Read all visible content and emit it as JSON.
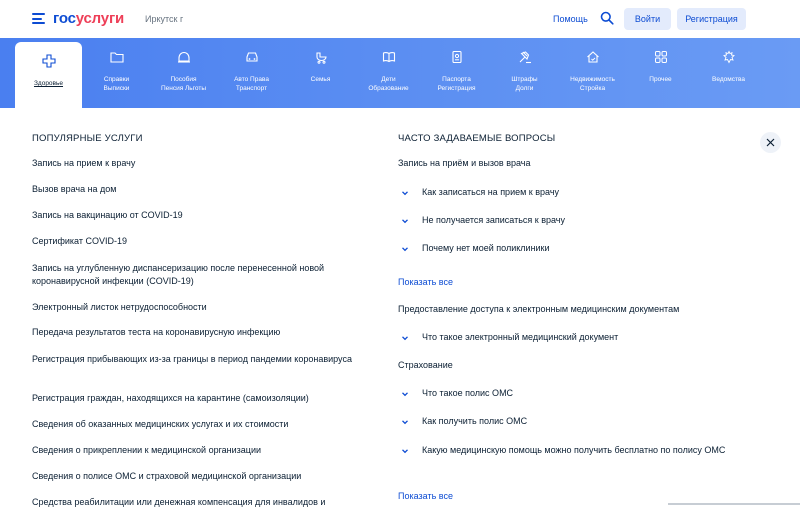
{
  "header": {
    "logo_part1": "гос",
    "logo_part2": "услуги",
    "city": "Иркутск г",
    "help": "Помощь",
    "login": "Войти",
    "register": "Регистрация",
    "brand_blue": "#0d4cd3",
    "brand_red": "#ee3f58"
  },
  "categories": [
    {
      "label1": "Здоровье",
      "label2": "",
      "icon": "cross-icon",
      "active": true
    },
    {
      "label1": "Справки",
      "label2": "Выписки",
      "icon": "folder-icon"
    },
    {
      "label1": "Пособия",
      "label2": "Пенсия Льготы",
      "icon": "wallet-icon"
    },
    {
      "label1": "Авто Права",
      "label2": "Транспорт",
      "icon": "car-icon"
    },
    {
      "label1": "Семья",
      "label2": "",
      "icon": "stroller-icon"
    },
    {
      "label1": "Дети",
      "label2": "Образование",
      "icon": "book-icon"
    },
    {
      "label1": "Паспорта",
      "label2": "Регистрация",
      "icon": "passport-icon"
    },
    {
      "label1": "Штрафы",
      "label2": "Долги",
      "icon": "gavel-icon"
    },
    {
      "label1": "Недвижимость",
      "label2": "Стройка",
      "icon": "house-icon"
    },
    {
      "label1": "Прочее",
      "label2": "",
      "icon": "grid-icon"
    },
    {
      "label1": "Ведомства",
      "label2": "",
      "icon": "emblem-icon"
    }
  ],
  "popular": {
    "title": "ПОПУЛЯРНЫЕ УСЛУГИ",
    "items": [
      "Запись на прием к врачу",
      "Вызов врача на дом",
      "Запись на вакцинацию от COVID-19",
      "Сертификат COVID-19",
      "Запись на углубленную диспансеризацию после перенесенной новой коронавирусной инфекции (COVID-19)",
      "Электронный листок нетрудоспособности",
      "Передача результатов теста на коронавирусную инфекцию",
      "Регистрация прибывающих из-за границы в период пандемии коронавируса",
      "Регистрация граждан, находящихся на карантине (самоизоляции)",
      "Сведения об оказанных медицинских услугах и их стоимости",
      "Сведения о прикреплении к медицинской организации",
      "Сведения о полисе ОМС и страховой медицинской организации",
      "Средства реабилитации или денежная компенсация для инвалидов и"
    ]
  },
  "faq": {
    "title": "ЧАСТО ЗАДАВАЕМЫЕ ВОПРОСЫ",
    "groups": [
      {
        "title": "Запись на приём и вызов врача",
        "questions": [
          "Как записаться на прием к врачу",
          "Не получается записаться к врачу",
          "Почему нет моей поликлиники"
        ],
        "show_all": "Показать все"
      },
      {
        "title": "Предоставление доступа к электронным медицинским документам",
        "questions": [
          "Что такое электронный медицинский документ"
        ]
      },
      {
        "title": "Страхование",
        "questions": [
          "Что такое полис ОМС",
          "Как получить полис ОМС",
          "Какую медицинскую помощь можно получить бесплатно по полису ОМС"
        ],
        "show_all": "Показать все"
      }
    ]
  }
}
